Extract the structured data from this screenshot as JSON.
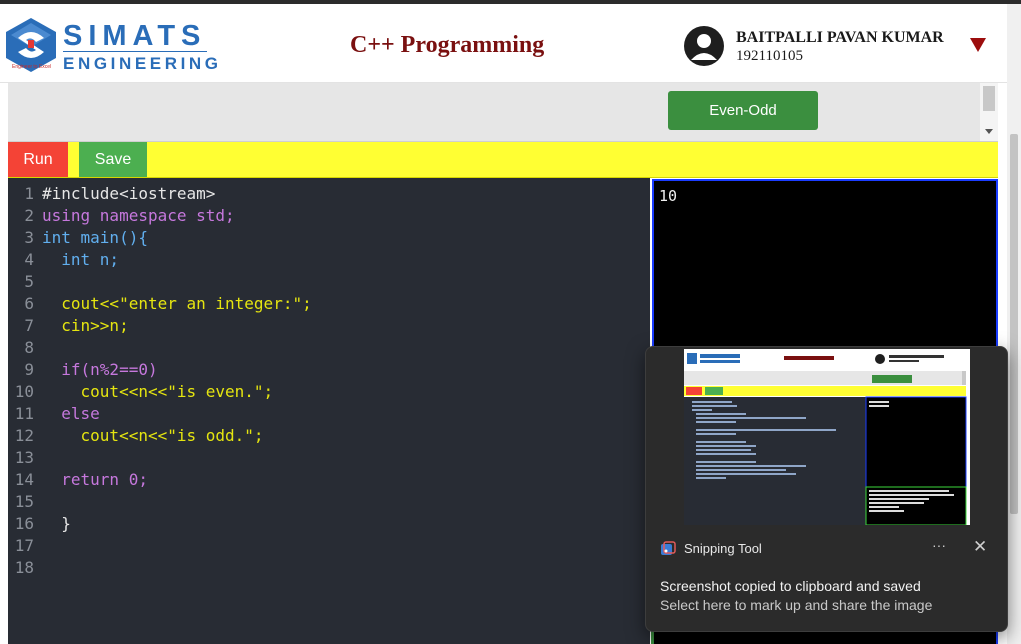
{
  "header": {
    "brand_main": "SIMATS",
    "brand_sub": "ENGINEERING",
    "tagline": "Engineer to Excel",
    "title": "C++ Programming",
    "user_name": "BAITPALLI PAVAN KUMAR",
    "user_id": "192110105"
  },
  "question": {
    "button_label": "Even-Odd"
  },
  "toolbar": {
    "run_label": "Run",
    "save_label": "Save"
  },
  "editor": {
    "line_numbers": [
      "1",
      "2",
      "3",
      "4",
      "5",
      "6",
      "7",
      "8",
      "9",
      "10",
      "11",
      "12",
      "13",
      "14",
      "15",
      "16",
      "17",
      "18"
    ],
    "lines": [
      "#include<iostream>",
      "using namespace std;",
      "int main(){",
      "  int n;",
      "",
      "  cout<<\"enter an integer:\";",
      "  cin>>n;",
      "",
      "  if(n%2==0)",
      "    cout<<n<<\"is even.\";",
      "  else",
      "    cout<<n<<\"is odd.\";",
      "",
      "  return 0;",
      "",
      "  }",
      "",
      ""
    ]
  },
  "output": {
    "text": "10"
  },
  "toast": {
    "app_name": "Snipping Tool",
    "more_label": "···",
    "close_label": "✕",
    "title": "Screenshot copied to clipboard and saved",
    "subtitle": "Select here to mark up and share the image"
  },
  "colors": {
    "accent_blue": "#2a6db8",
    "title_red": "#7a1010",
    "run_red": "#f44336",
    "save_green": "#4caf50",
    "toolbar_yellow": "#ffff33",
    "editor_bg": "#282c34"
  },
  "icons": {
    "logo": "simats-logo",
    "avatar": "user-avatar-icon",
    "menu": "caret-down-icon",
    "toast_app": "snipping-tool-icon",
    "toast_close": "close-icon"
  }
}
